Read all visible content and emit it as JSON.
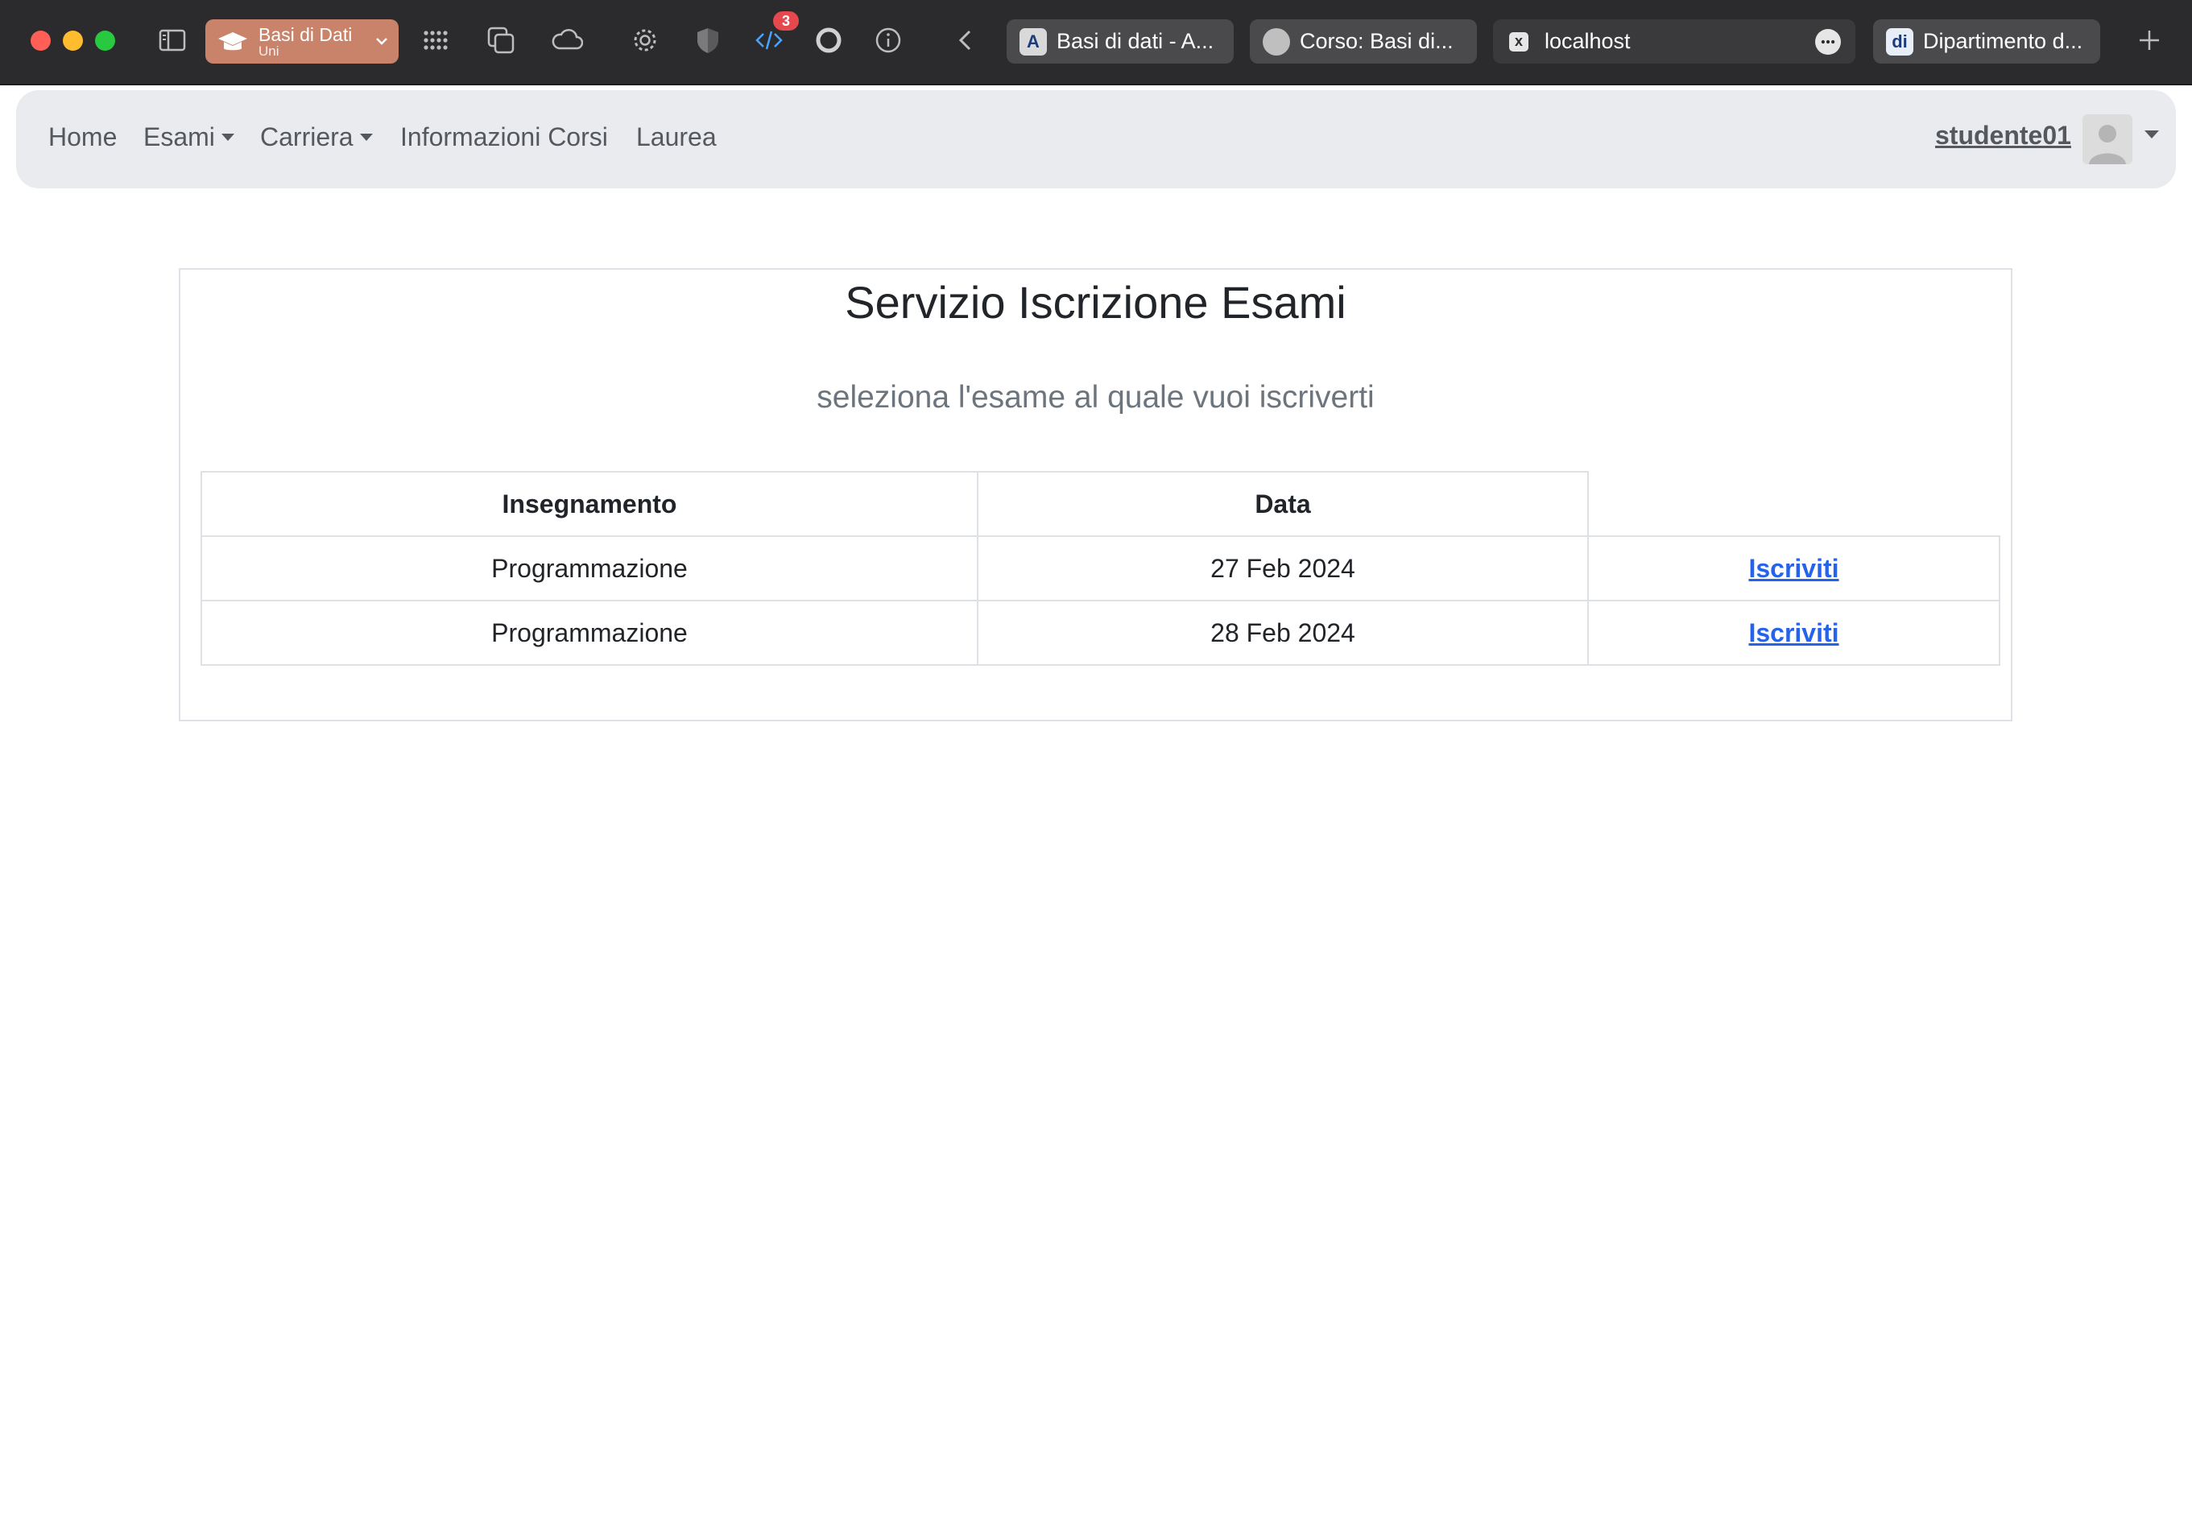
{
  "browser": {
    "profile": {
      "name": "Basi di Dati",
      "subtitle": "Uni"
    },
    "devtools_badge": "3",
    "tabs": [
      {
        "label": "Basi di dati - A...",
        "favicon": "A"
      },
      {
        "label": "Corso: Basi di...",
        "favicon": ""
      },
      {
        "label": "localhost",
        "favicon": "x"
      },
      {
        "label": "Dipartimento d...",
        "favicon": "di"
      }
    ]
  },
  "navbar": {
    "items": [
      {
        "label": "Home"
      },
      {
        "label": "Esami"
      },
      {
        "label": "Carriera"
      },
      {
        "label": "Informazioni Corsi"
      },
      {
        "label": "Laurea"
      }
    ],
    "user": "studente01"
  },
  "main": {
    "title": "Servizio Iscrizione Esami",
    "subtitle": "seleziona l'esame al quale vuoi iscriverti",
    "table": {
      "headers": [
        "Insegnamento",
        "Data",
        ""
      ],
      "rows": [
        {
          "course": "Programmazione",
          "date": "27 Feb 2024",
          "action": "Iscriviti"
        },
        {
          "course": "Programmazione",
          "date": "28 Feb 2024",
          "action": "Iscriviti"
        }
      ]
    }
  }
}
